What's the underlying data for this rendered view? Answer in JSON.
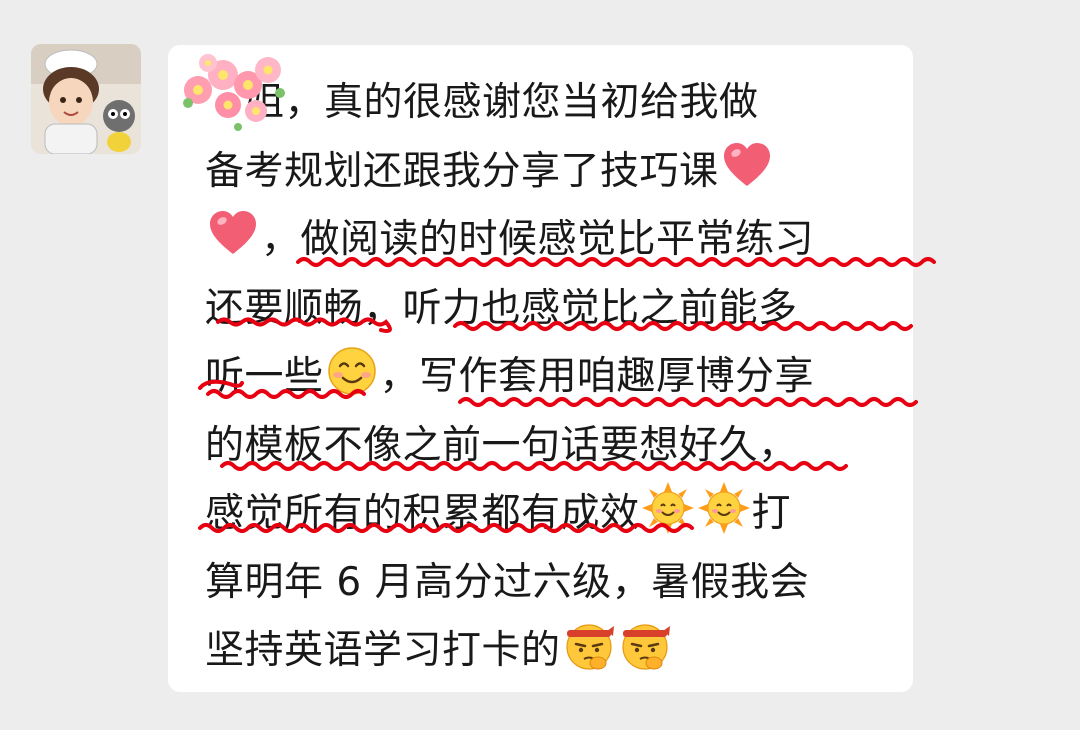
{
  "chat": {
    "message": {
      "lines": [
        "姐，真的很感谢您当初给我做",
        "备考规划还跟我分享了技巧课",
        "，做阅读的时候感觉比平常练习",
        "还要顺畅，听力也感觉比之前能多",
        "听一些",
        "，写作套用咱趣厚博分享",
        "的模板不像之前一句话要想好久，",
        "感觉所有的积累都有成效",
        "打",
        "算明年 6 月高分过六级，暑假我会",
        "坚持英语学习打卡的"
      ]
    },
    "emojis": {
      "heart": "heart-emoji",
      "smile": "smiling-face-emoji",
      "sun": "sun-with-face-emoji",
      "thinking": "determined-thinking-face-emoji",
      "flowers": "cherry-blossom-sticker"
    },
    "colors": {
      "background": "#ededed",
      "bubble": "#ffffff",
      "text": "#191919",
      "underline": "#e60012"
    }
  }
}
